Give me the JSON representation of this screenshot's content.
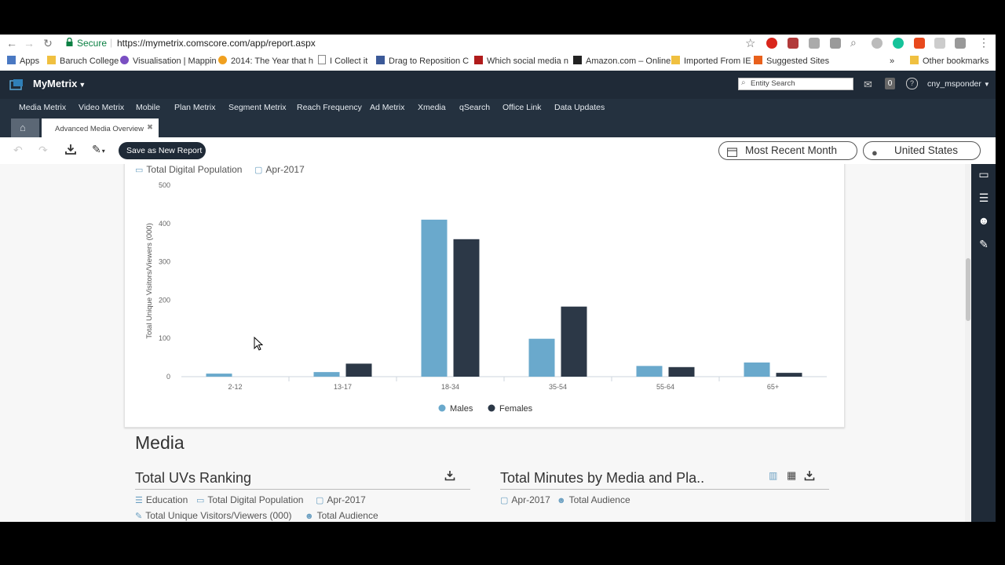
{
  "browser": {
    "secure_label": "Secure",
    "url": "https://mymetrix.comscore.com/app/report.aspx",
    "bookmarks": [
      {
        "label": "Apps",
        "color": "#4a78c2"
      },
      {
        "label": "Baruch College",
        "color": "#f0c040"
      },
      {
        "label": "Visualisation | Mappin",
        "color": "#7a4fc2"
      },
      {
        "label": "2014: The Year that h",
        "color": "#f0a020"
      },
      {
        "label": "I Collect it",
        "color": "#888888"
      },
      {
        "label": "Drag to Reposition C",
        "color": "#3b5998"
      },
      {
        "label": "Which social media n",
        "color": "#b01b1b"
      },
      {
        "label": "Amazon.com – Online",
        "color": "#222222"
      },
      {
        "label": "Imported From IE",
        "color": "#f0c040"
      },
      {
        "label": "Suggested Sites",
        "color": "#e8601c"
      }
    ],
    "overflow": "»",
    "other_bookmarks": "Other bookmarks"
  },
  "app": {
    "brand": "MyMetrix",
    "search_placeholder": "Entity Search",
    "notif_count": "0",
    "user": "cny_msponder",
    "nav": [
      "Media Metrix",
      "Video Metrix",
      "Mobile",
      "Plan Metrix",
      "Segment Metrix",
      "Reach Frequency",
      "Ad Metrix",
      "Xmedia",
      "qSearch",
      "Office Link",
      "Data Updates"
    ],
    "tab_label": "Advanced Media Overview",
    "tab_close": "✖",
    "save_report": "Save as New Report",
    "period": "Most Recent Month",
    "country": "United States"
  },
  "top_meta": {
    "population": "Total Digital Population",
    "date": "Apr-2017"
  },
  "chart_data": {
    "type": "bar",
    "ylabel": "Total Unique Visitors/Viewers (000)",
    "ylim": [
      0,
      500
    ],
    "yticks": [
      "0",
      "100",
      "200",
      "300",
      "400",
      "500"
    ],
    "categories": [
      "2-12",
      "13-17",
      "18-34",
      "35-54",
      "55-64",
      "65+"
    ],
    "series": [
      {
        "name": "Males",
        "color": "#6aa9cc",
        "values": [
          8,
          12,
          410,
          99,
          28,
          37
        ]
      },
      {
        "name": "Females",
        "color": "#2c3847",
        "values": [
          0,
          34,
          359,
          183,
          25,
          10
        ]
      }
    ],
    "legend": "bottom"
  },
  "media": {
    "heading": "Media",
    "left_title": "Total UVs Ranking",
    "left_meta": [
      "Education",
      "Total Digital Population",
      "Apr-2017",
      "Total Unique Visitors/Viewers (000)",
      "Total Audience"
    ],
    "right_title": "Total Minutes by Media and Pla..",
    "right_meta": [
      "Apr-2017",
      "Total Audience"
    ]
  }
}
